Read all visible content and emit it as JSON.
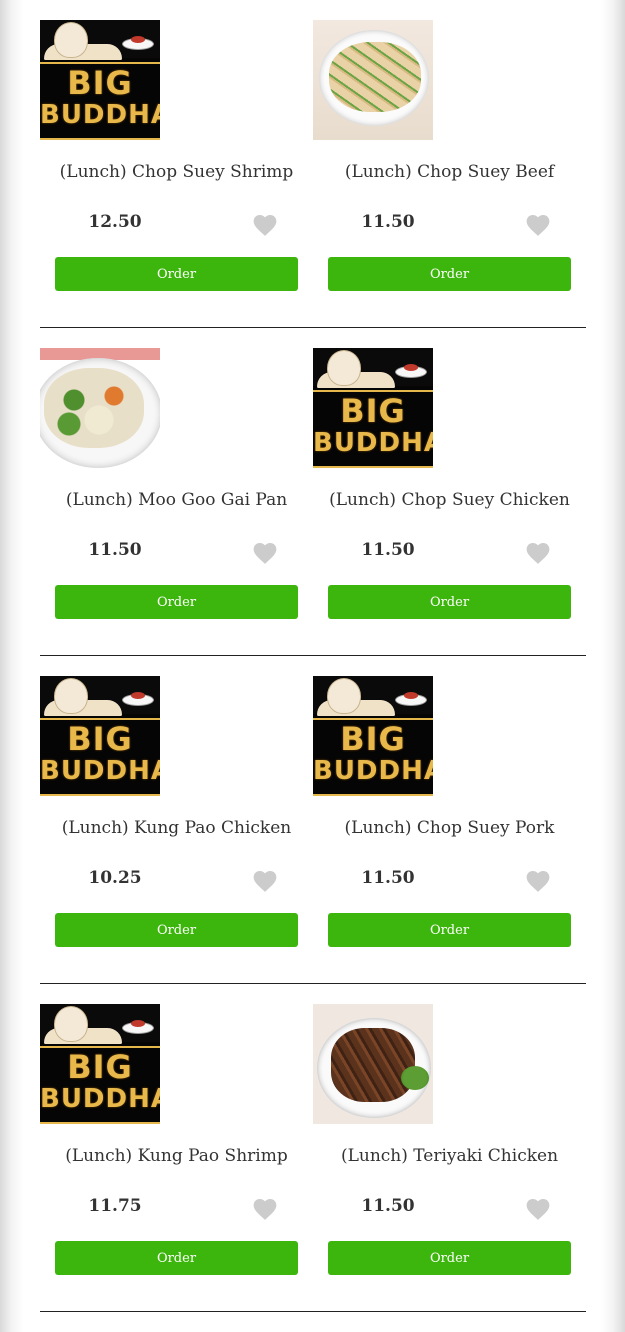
{
  "menu": {
    "items": [
      {
        "image": "big-buddha-logo",
        "logo_text_1": "BIG",
        "logo_text_2": "BUDDHA",
        "title": "(Lunch) Chop Suey Shrimp",
        "price": "12.50",
        "order_label": "Order"
      },
      {
        "image": "noodles-photo",
        "title": "(Lunch) Chop Suey Beef",
        "price": "11.50",
        "order_label": "Order"
      },
      {
        "image": "vegetable-chicken-photo",
        "title": "(Lunch) Moo Goo Gai Pan",
        "price": "11.50",
        "order_label": "Order"
      },
      {
        "image": "big-buddha-logo",
        "logo_text_1": "BIG",
        "logo_text_2": "BUDDHA",
        "title": "(Lunch) Chop Suey Chicken",
        "price": "11.50",
        "order_label": "Order"
      },
      {
        "image": "big-buddha-logo",
        "logo_text_1": "BIG",
        "logo_text_2": "BUDDHA",
        "title": "(Lunch) Kung Pao Chicken",
        "price": "10.25",
        "order_label": "Order"
      },
      {
        "image": "big-buddha-logo",
        "logo_text_1": "BIG",
        "logo_text_2": "BUDDHA",
        "title": "(Lunch) Chop Suey Pork",
        "price": "11.50",
        "order_label": "Order"
      },
      {
        "image": "big-buddha-logo",
        "logo_text_1": "BIG",
        "logo_text_2": "BUDDHA",
        "title": "(Lunch) Kung Pao Shrimp",
        "price": "11.75",
        "order_label": "Order"
      },
      {
        "image": "teriyaki-chicken-photo",
        "title": "(Lunch) Teriyaki Chicken",
        "price": "11.50",
        "order_label": "Order"
      }
    ]
  },
  "colors": {
    "order_button": "#3cb60c",
    "heart": "#cccccc",
    "logo_gold": "#e8b84a"
  },
  "icons": {
    "favorite": "heart-icon"
  }
}
